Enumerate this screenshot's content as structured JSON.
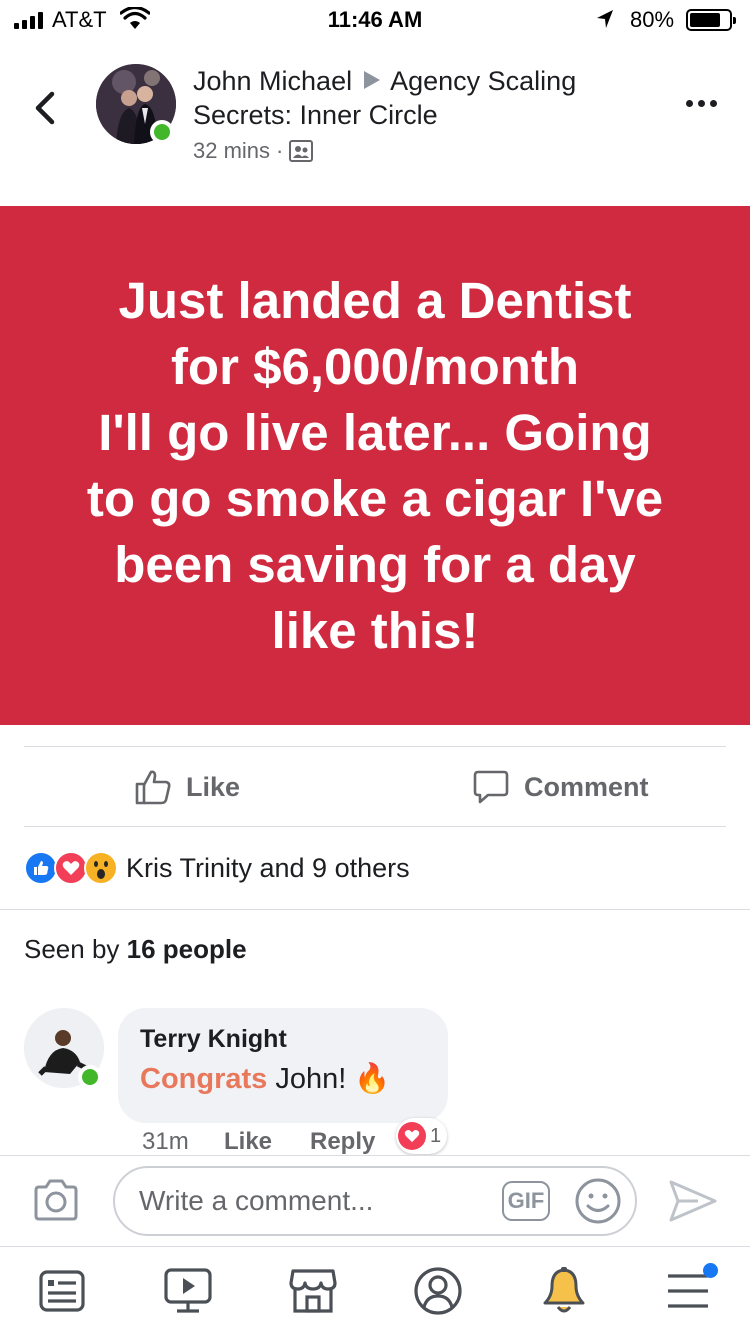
{
  "status_bar": {
    "carrier": "AT&T",
    "time": "11:46 AM",
    "battery": "80%"
  },
  "post": {
    "author": "John Michael",
    "group": "Agency Scaling Secrets: Inner Circle",
    "time_ago": "32 mins",
    "text": "Just landed a Dentist\nfor $6,000/month\nI'll go live later... Going\nto go smoke a cigar I've\nbeen saving for a day\nlike this!",
    "background_color": "#d02a40"
  },
  "actions": {
    "like_label": "Like",
    "comment_label": "Comment"
  },
  "reactions": {
    "icons": [
      "like-icon",
      "love-icon",
      "wow-icon"
    ],
    "summary": "Kris Trinity and 9 others"
  },
  "seen": {
    "prefix": "Seen by",
    "count": "16 people"
  },
  "comment": {
    "author": "Terry Knight",
    "text_highlight": "Congrats",
    "text_rest": "John!",
    "emoji": "🔥",
    "time": "31m",
    "like_label": "Like",
    "reply_label": "Reply",
    "reaction_count": "1"
  },
  "composer": {
    "placeholder": "Write a comment...",
    "gif_label": "GIF"
  },
  "tabbar": {
    "items": [
      "news-feed-icon",
      "watch-icon",
      "marketplace-icon",
      "profile-icon",
      "notifications-icon",
      "menu-icon"
    ]
  }
}
